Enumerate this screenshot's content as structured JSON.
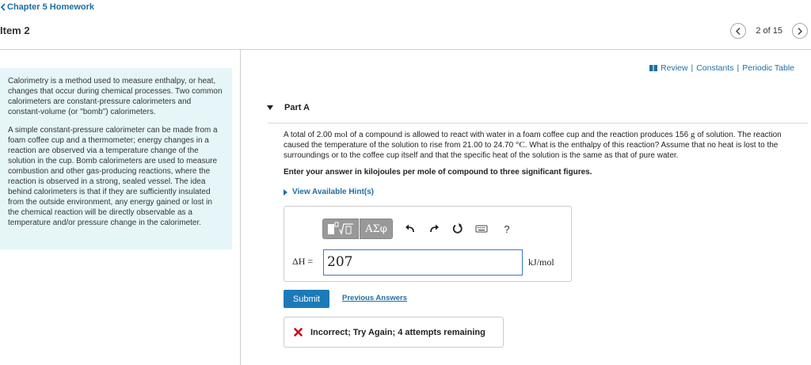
{
  "header": {
    "back_label": "Chapter 5 Homework",
    "item_title": "Item 2",
    "pager_text": "2 of 15"
  },
  "intro": {
    "paragraphs": [
      "Calorimetry is a method used to measure enthalpy, or heat, changes that occur during chemical processes. Two common calorimeters are constant-pressure calorimeters and constant-volume (or \"bomb\") calorimeters.",
      "A simple constant-pressure calorimeter can be made from a foam coffee cup and a thermometer; energy changes in a reaction are observed via a temperature change of the solution in the cup. Bomb calorimeters are used to measure combustion and other gas-producing reactions, where the reaction is observed in a strong, sealed vessel. The idea behind calorimeters is that if they are sufficiently insulated from the outside environment, any energy gained or lost in the chemical reaction will be directly observable as a temperature and/or pressure change in the calorimeter."
    ]
  },
  "toplinks": {
    "review": "Review",
    "constants": "Constants",
    "periodic": "Periodic Table",
    "sep": "|"
  },
  "part": {
    "label": "Part A",
    "q1": "A total of 2.00 ",
    "q_mol": "mol",
    "q2": " of a compound is allowed to react with water in a foam coffee cup and the reaction produces 156 ",
    "q_g": "g",
    "q3": " of solution. The reaction caused the temperature of the solution to rise from 21.00  to 24.70 ",
    "q_deg": "°C",
    "q4": ". What is the enthalpy of this reaction? Assume that no heat is lost to the surroundings or to the coffee cup itself and that the specific heat of the solution is the same as that of pure water.",
    "instruction": "Enter your answer in kilojoules per mole of compound to three significant figures.",
    "hints_label": "View Available Hint(s)"
  },
  "answer": {
    "greek_label": "ΑΣφ",
    "help_label": "?",
    "delta_label": "ΔH =",
    "value": "207",
    "unit": "kJ/mol"
  },
  "actions": {
    "submit": "Submit",
    "previous": "Previous Answers"
  },
  "feedback": {
    "text": "Incorrect; Try Again; 4 attempts remaining"
  },
  "colors": {
    "link": "#1d6fa5",
    "submit_bg": "#1d7ab8",
    "intro_bg": "#e6f6f8",
    "error": "#d0021b",
    "toolbar_btn": "#999999"
  },
  "icons": [
    "chevron-left-icon",
    "chevron-right-icon",
    "book-icon",
    "undo-icon",
    "redo-icon",
    "reset-icon",
    "keyboard-icon",
    "x-mark-icon"
  ]
}
